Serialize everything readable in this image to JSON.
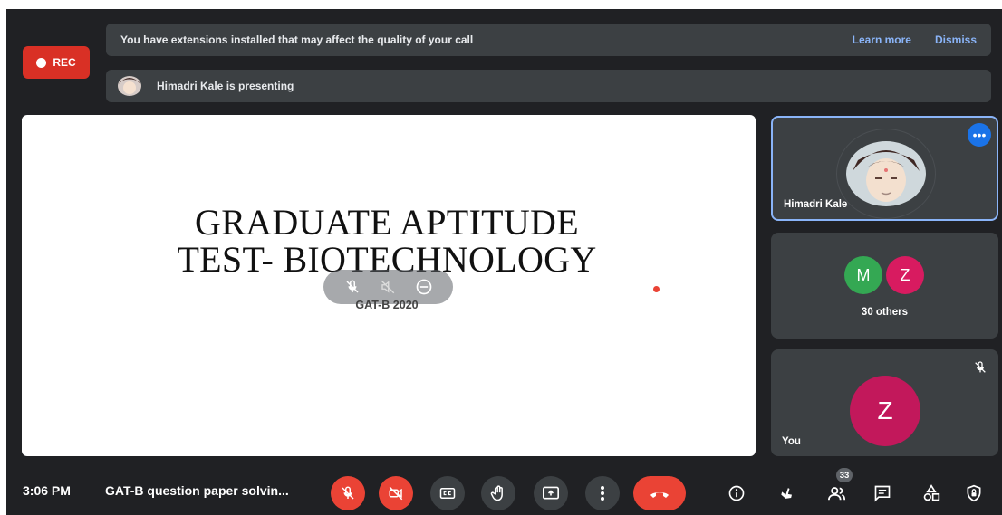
{
  "recording": {
    "label": "REC"
  },
  "notification": {
    "message": "You have extensions installed that may affect the quality of your call",
    "learn_more": "Learn more",
    "dismiss": "Dismiss"
  },
  "presenting": {
    "text": "Himadri Kale is presenting"
  },
  "slide": {
    "title_line1": "GRADUATE APTITUDE",
    "title_line2": "TEST- BIOTECHNOLOGY",
    "subtitle": "GAT-B 2020"
  },
  "participants": {
    "presenter": {
      "name": "Himadri Kale"
    },
    "group": {
      "initials": [
        "M",
        "Z"
      ],
      "label": "30 others",
      "colors": [
        "#34a853",
        "#d81b60"
      ]
    },
    "self": {
      "initial": "Z",
      "name": "You",
      "color": "#c2185b"
    }
  },
  "bottom_bar": {
    "time": "3:06 PM",
    "meeting_title": "GAT-B question paper solvin...",
    "people_count": "33"
  },
  "colors": {
    "background": "#202124",
    "danger": "#ea4335",
    "accent": "#8ab4f8",
    "surface": "#3c4043"
  }
}
